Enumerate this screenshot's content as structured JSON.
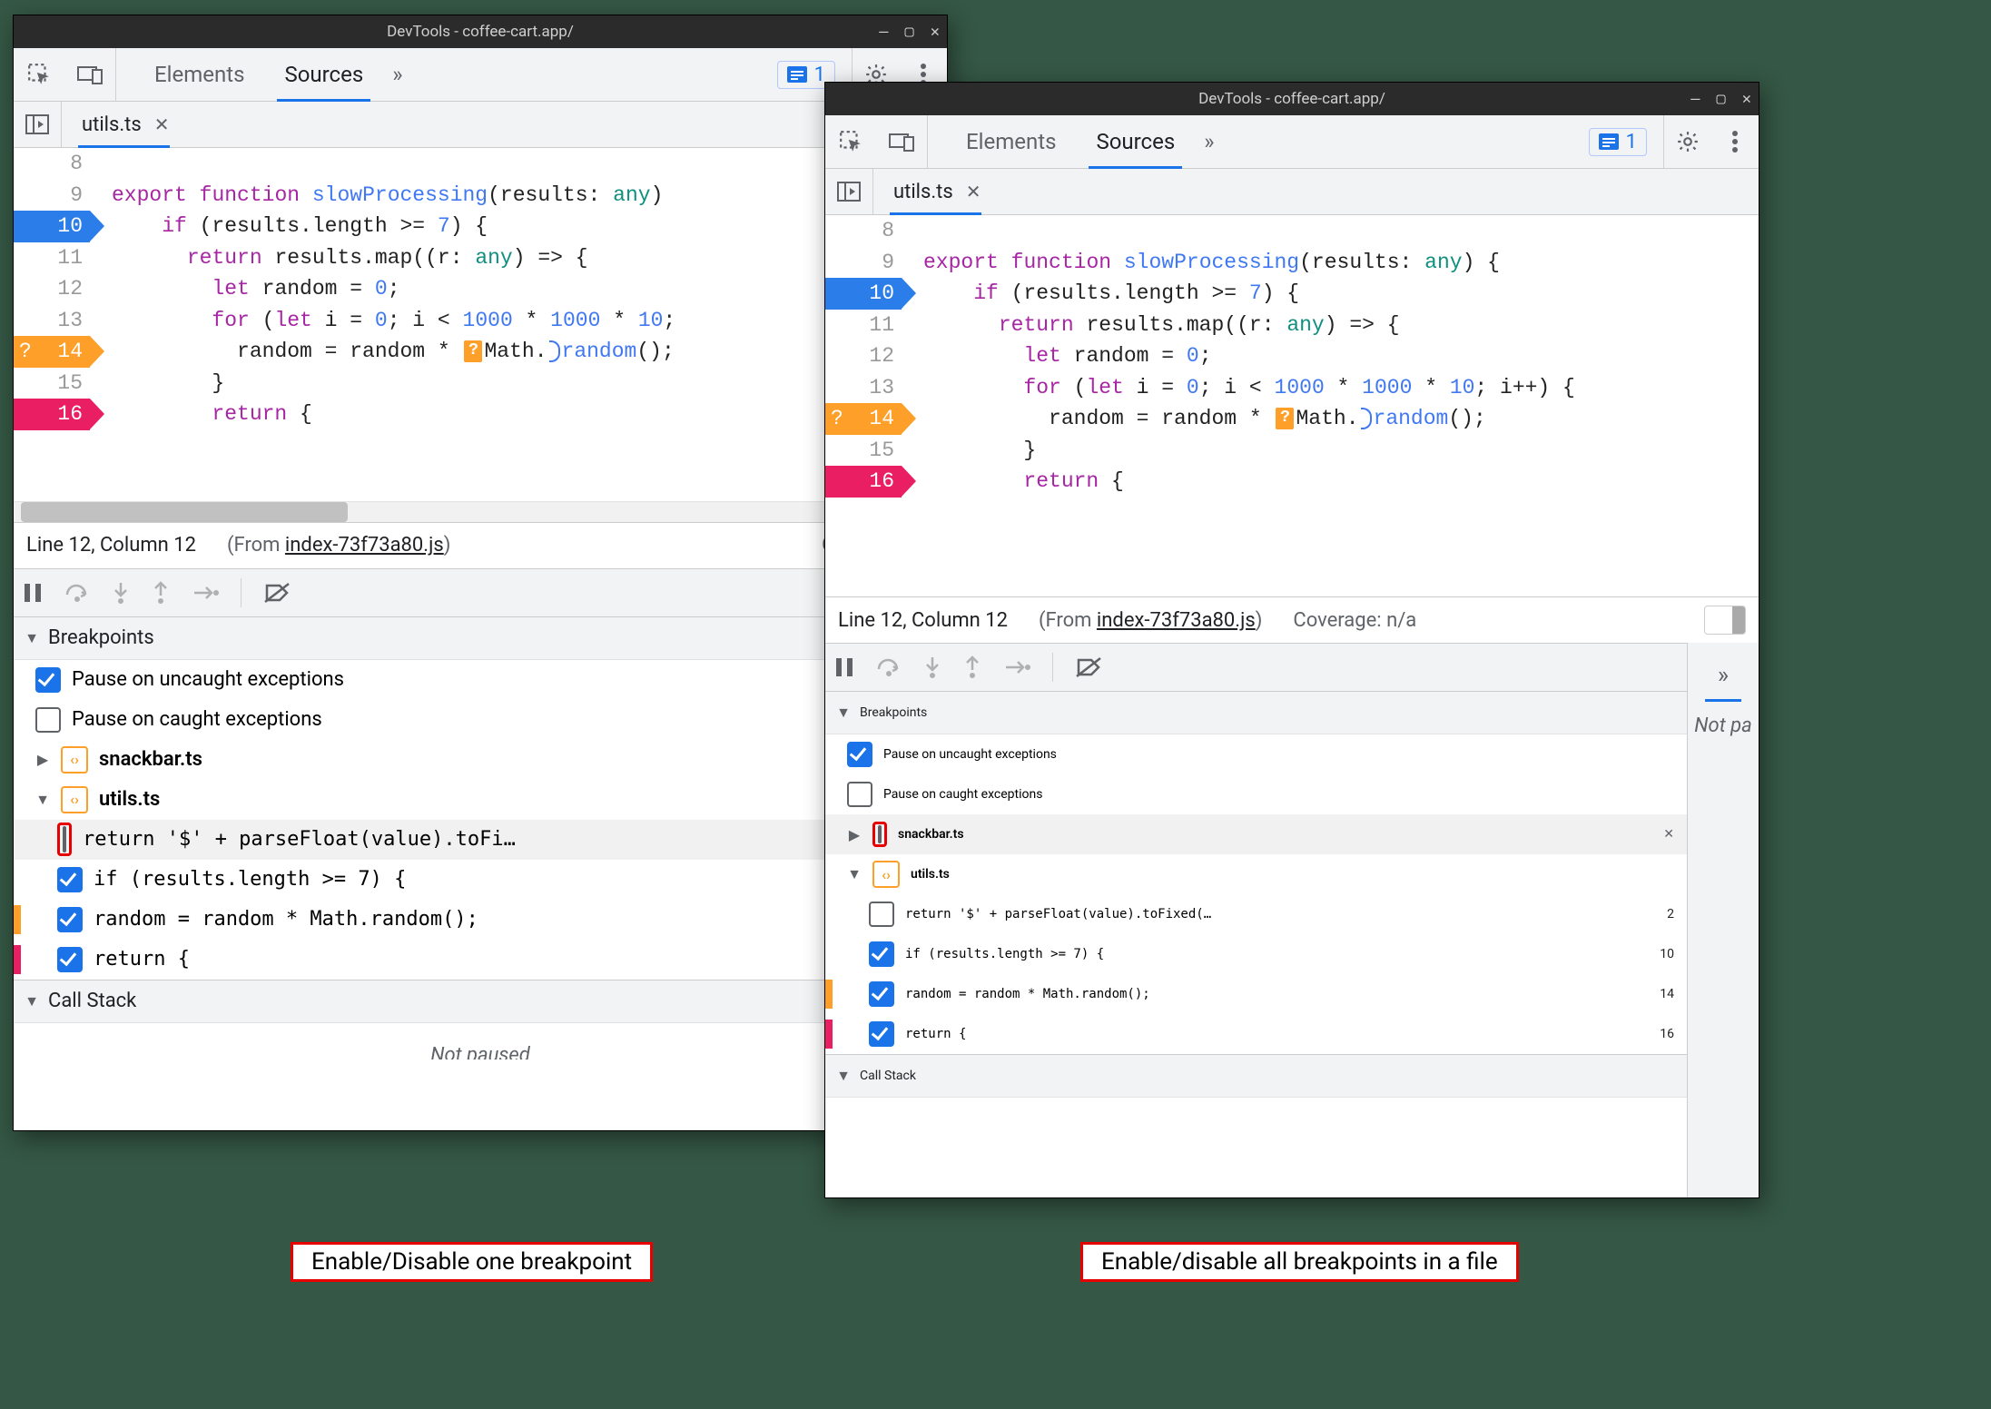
{
  "titlebar": {
    "text": "DevTools - coffee-cart.app/"
  },
  "panelTabs": {
    "elements": "Elements",
    "sources": "Sources",
    "more": "»"
  },
  "issues": {
    "count": "1"
  },
  "fileTab": {
    "name": "utils.ts"
  },
  "codeLines": {
    "l8": "",
    "l9_a": "export",
    "l9_b": "function",
    "l9_c": "slowProcessing",
    "l9_d": "(",
    "l9_e": "results",
    "l9_f": ": ",
    "l9_g": "any",
    "l9_h_left": ")",
    "l9_h_right": ") {",
    "l10": "    if (results.length >= 7) {",
    "l10_kw": "if",
    "l10_rest": " (results.length >= ",
    "l10_num": "7",
    "l10_tail": ") {",
    "l11_a": "return",
    "l11_b": " results.map((",
    "l11_c": "r",
    "l11_d": ": ",
    "l11_e": "any",
    "l11_f": ") => {",
    "l12_a": "let",
    "l12_b": " random = ",
    "l12_c": "0",
    "l12_d": ";",
    "l13_a": "for",
    "l13_b": " (",
    "l13_c": "let",
    "l13_d": " i = ",
    "l13_e": "0",
    "l13_f": "; i < ",
    "l13_g": "1000",
    "l13_h": " * ",
    "l13_i": "1000",
    "l13_j": " * ",
    "l13_k": "10",
    "l13_l_left": ";",
    "l13_l_right": "; i++) {",
    "l14_a": "random = random * ",
    "l14_b": "Math",
    "l14_c": ".",
    "l14_d": "random",
    "l14_e": "();",
    "l15": "}",
    "l16_a": "return",
    "l16_b": " {"
  },
  "status": {
    "pos": "Line 12, Column 12",
    "fromPre": "(From ",
    "fromFile": "index-73f73a80.js",
    "fromPost": ")",
    "coverageLeft": "Coverage: n/",
    "coverageRight": "Coverage: n/a"
  },
  "panes": {
    "breakpoints": "Breakpoints",
    "callstack": "Call Stack",
    "notPaused": "Not paused",
    "notPausedCutR": "Not pa"
  },
  "bpOptions": {
    "uncaught": "Pause on uncaught exceptions",
    "caught": "Pause on caught exceptions"
  },
  "bpFiles": {
    "snackbar": "snackbar.ts",
    "utils": "utils.ts"
  },
  "bpItems": {
    "parseFloatLeft": "return '$' + parseFloat(value).toFi…",
    "parseFloatRight": "return '$' + parseFloat(value).toFixed(…",
    "ifResults": "if (results.length >= 7) {",
    "randomMath": "random = random * Math.random();",
    "returnBrace": "return {"
  },
  "bpLineNums": {
    "parseFloat": "2",
    "ifResults": "10",
    "randomMath": "14",
    "returnBrace": "16"
  },
  "captions": {
    "one": "Enable/Disable one breakpoint",
    "all": "Enable/disable all breakpoints in a file"
  },
  "rightSide": {
    "more": "»"
  }
}
